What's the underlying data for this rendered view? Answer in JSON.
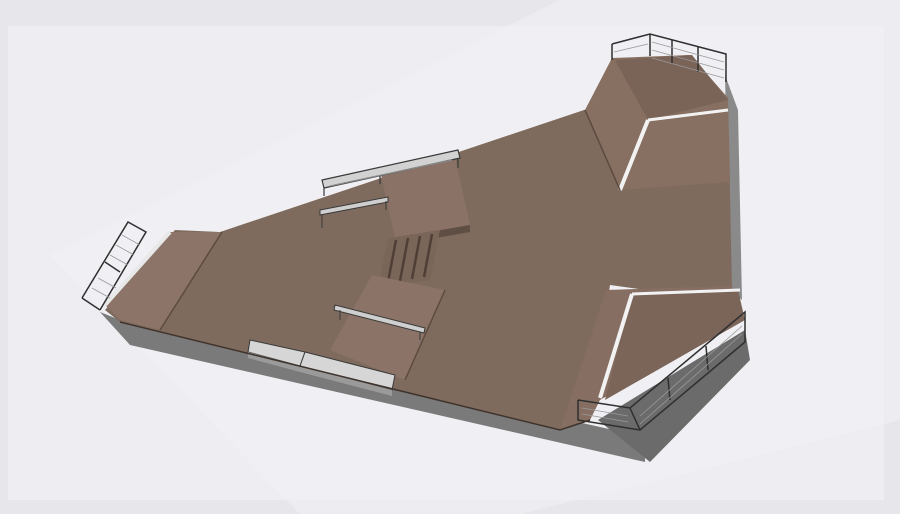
{
  "scene": {
    "subject": "skatepark-3d-model",
    "colors": {
      "background": "#e7e7eb",
      "panel": "#eeeef2",
      "deck_surface": "#7f6b5e",
      "deck_shadow": "#6e5c50",
      "ramp_face": "#8a7466",
      "side_wall": "#7b7b7b",
      "side_wall_dark": "#5e5e5e",
      "rail_metal": "#c9c9c9",
      "rail_outline": "#3a3a3a"
    },
    "icons": [
      "handrail",
      "guardrail",
      "ledge-box",
      "stair-set",
      "quarter-pipe"
    ]
  }
}
